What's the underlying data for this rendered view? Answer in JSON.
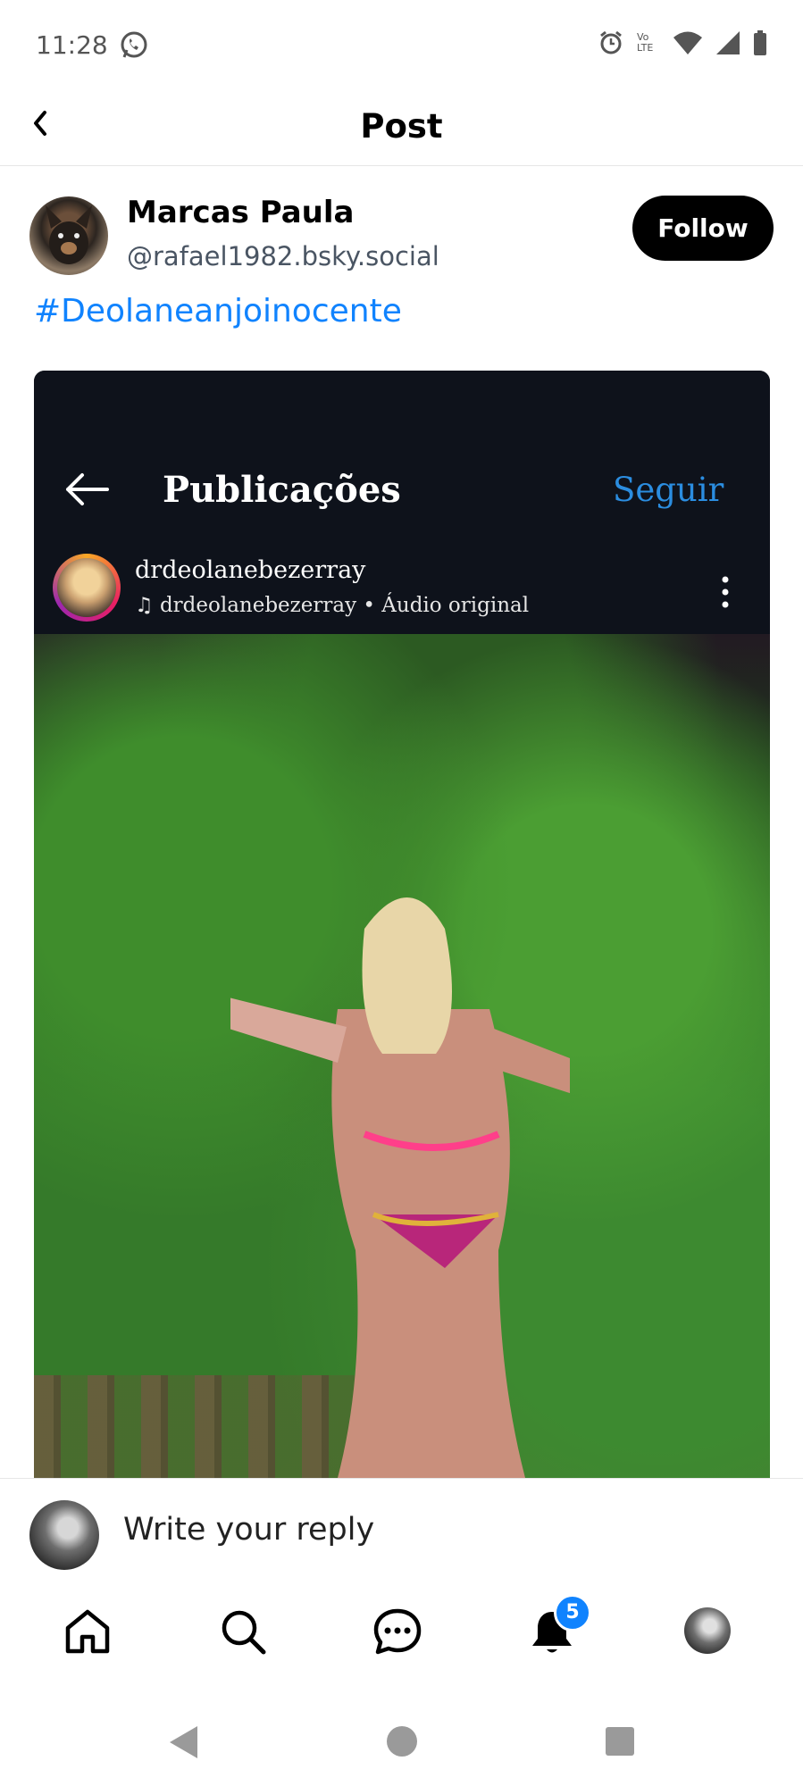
{
  "status_bar": {
    "time": "11:28",
    "icons": [
      "whatsapp-icon",
      "alarm-icon",
      "volte-icon",
      "wifi-icon",
      "signal-icon",
      "battery-icon"
    ],
    "volte_label": "Vo LTE"
  },
  "header": {
    "title": "Post",
    "back_icon": "chevron-left-icon"
  },
  "post": {
    "author_name": "Marcas Paula",
    "author_handle": "@rafael1982.bsky.social",
    "follow_label": "Follow",
    "text": "#Deolaneanjoinocente",
    "embedded_image": {
      "screen_title": "Publicações",
      "follow_label": "Seguir",
      "username": "drdeolanebezerray",
      "audio": "drdeolanebezerray • Áudio original"
    }
  },
  "reply": {
    "placeholder": "Write your reply"
  },
  "bottom_nav": {
    "items": [
      "home-icon",
      "search-icon",
      "chat-icon",
      "notifications-icon",
      "profile-avatar"
    ],
    "notification_count": "5"
  },
  "system_nav": [
    "back-triangle",
    "home-circle",
    "recents-square"
  ],
  "colors": {
    "accent": "#1083fe",
    "follow_bg": "#000000",
    "ig_blue": "#2b8de0"
  }
}
